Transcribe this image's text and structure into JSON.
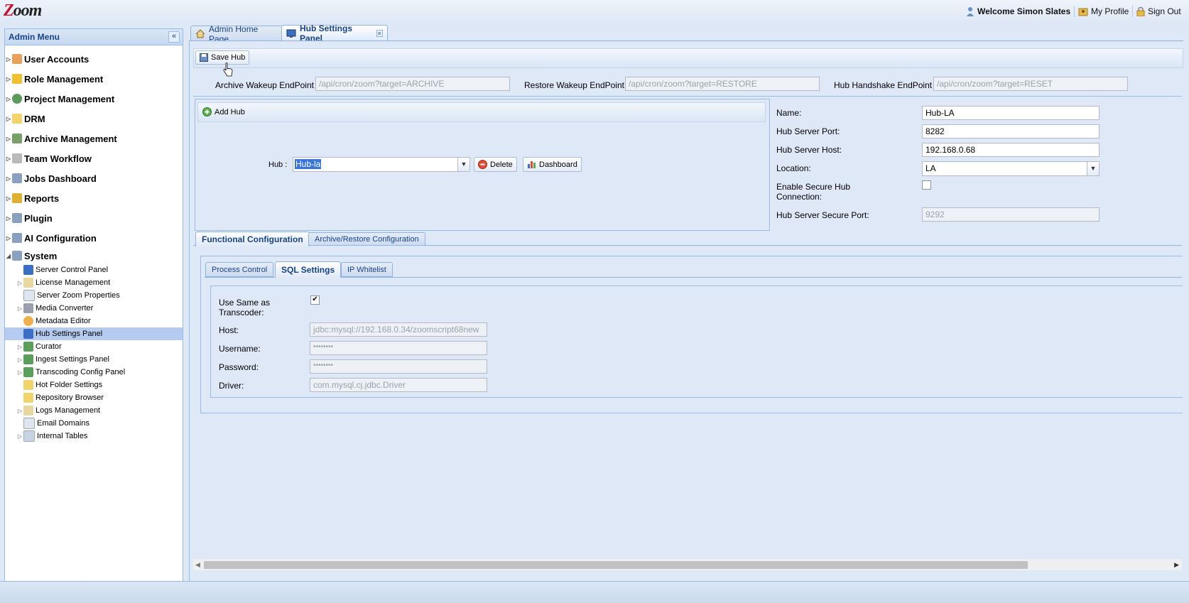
{
  "app": {
    "logo": "Zoom"
  },
  "topnav": {
    "welcome": "Welcome Simon Slates",
    "my_profile": "My Profile",
    "sign_out": "Sign Out"
  },
  "sidebar": {
    "title": "Admin Menu",
    "items": [
      {
        "label": "User Accounts",
        "icon": "user-icon"
      },
      {
        "label": "Role Management",
        "icon": "shield-icon"
      },
      {
        "label": "Project Management",
        "icon": "globe-icon"
      },
      {
        "label": "DRM",
        "icon": "folder-icon"
      },
      {
        "label": "Archive Management",
        "icon": "archive-icon"
      },
      {
        "label": "Team Workflow",
        "icon": "workflow-icon"
      },
      {
        "label": "Jobs Dashboard",
        "icon": "monitor-icon"
      },
      {
        "label": "Reports",
        "icon": "reports-icon"
      },
      {
        "label": "Plugin",
        "icon": "plugin-icon"
      },
      {
        "label": "AI Configuration",
        "icon": "monitor-icon"
      },
      {
        "label": "System",
        "icon": "monitor-icon"
      }
    ],
    "system_children": [
      {
        "label": "Server Control Panel",
        "icon": "monitor-icon"
      },
      {
        "label": "License Management",
        "icon": "pencil-icon"
      },
      {
        "label": "Server Zoom Properties",
        "icon": "document-icon"
      },
      {
        "label": "Media Converter",
        "icon": "media-icon"
      },
      {
        "label": "Metadata Editor",
        "icon": "search-icon"
      },
      {
        "label": "Hub Settings Panel",
        "icon": "monitor-icon"
      },
      {
        "label": "Curator",
        "icon": "hierarchy-icon"
      },
      {
        "label": "Ingest Settings Panel",
        "icon": "hierarchy-icon"
      },
      {
        "label": "Transcoding Config Panel",
        "icon": "hierarchy-icon"
      },
      {
        "label": "Hot Folder Settings",
        "icon": "folder-icon"
      },
      {
        "label": "Repository Browser",
        "icon": "folder-icon"
      },
      {
        "label": "Logs Management",
        "icon": "pencil-icon"
      },
      {
        "label": "Email Domains",
        "icon": "document-icon"
      },
      {
        "label": "Internal Tables",
        "icon": "table-icon"
      }
    ]
  },
  "tabs": {
    "home": "Admin Home Page",
    "hub": "Hub Settings Panel"
  },
  "toolbar": {
    "save_hub": "Save Hub"
  },
  "endpoints": {
    "archive_label": "Archive Wakeup EndPoint :",
    "archive_value": "/api/cron/zoom?target=ARCHIVE",
    "restore_label": "Restore Wakeup EndPoint :",
    "restore_value": "/api/cron/zoom?target=RESTORE",
    "handshake_label": "Hub Handshake EndPoint :",
    "handshake_value": "/api/cron/zoom?target=RESET"
  },
  "hub_panel": {
    "add_hub": "Add Hub",
    "hub_label": "Hub :",
    "hub_value": "Hub-la",
    "delete": "Delete",
    "dashboard": "Dashboard"
  },
  "hub_form": {
    "name_label": "Name:",
    "name_value": "Hub-LA",
    "port_label": "Hub Server Port:",
    "port_value": "8282",
    "host_label": "Hub Server Host:",
    "host_value": "192.168.0.68",
    "location_label": "Location:",
    "location_value": "LA",
    "secure_label_1": "Enable Secure Hub",
    "secure_label_2": "Connection:",
    "secure_checked": false,
    "secure_port_label": "Hub Server Secure Port:",
    "secure_port_value": "9292"
  },
  "config_tabs": {
    "functional": "Functional Configuration",
    "archive_restore": "Archive/Restore Configuration"
  },
  "sub_tabs": {
    "process_control": "Process Control",
    "sql_settings": "SQL Settings",
    "ip_whitelist": "IP Whitelist"
  },
  "sql": {
    "same_label_1": "Use Same as",
    "same_label_2": "Transcoder:",
    "same_checked": true,
    "host_label": "Host:",
    "host_value": "jdbc:mysql://192.168.0.34/zoomscript68new",
    "username_label": "Username:",
    "username_value": "••••••••",
    "password_label": "Password:",
    "password_value": "••••••••",
    "driver_label": "Driver:",
    "driver_value": "com.mysql.cj.jdbc.Driver"
  },
  "colors": {
    "accent": "#15428b",
    "selected": "#b5cbf0",
    "background": "#dfe8f6",
    "border": "#99bbe8"
  }
}
